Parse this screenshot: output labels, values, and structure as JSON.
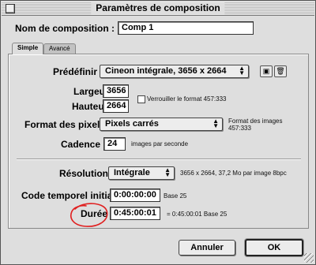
{
  "window": {
    "title": "Paramètres de composition"
  },
  "comp_name": {
    "label": "Nom de composition :",
    "value": "Comp 1"
  },
  "tabs": [
    {
      "label": "Simple"
    },
    {
      "label": "Avancé"
    }
  ],
  "preset": {
    "label": "Prédéfinir :",
    "value": "Cineon intégrale, 3656 x 2664",
    "save_icon": "disk-icon",
    "delete_icon": "trash-icon"
  },
  "width": {
    "label": "Largeur :",
    "value": "3656"
  },
  "height": {
    "label": "Hauteur :",
    "value": "2664"
  },
  "lock_ratio": {
    "label": "Verrouiller le format 457:333",
    "checked": false
  },
  "pixel_format": {
    "label": "Format des pixels :",
    "value": "Pixels carrés",
    "aspect_caption": "Format des images",
    "aspect_value": "457:333"
  },
  "frame_rate": {
    "label": "Cadence :",
    "value": "24",
    "unit": "images par seconde"
  },
  "resolution": {
    "label": "Résolution :",
    "value": "Intégrale",
    "info": "3656 x 2664, 37,2 Mo par image 8bpc"
  },
  "start_timecode": {
    "label": "Code temporel initial :",
    "value": "0:00:00:00",
    "base": "Base 25"
  },
  "duration": {
    "label": "Durée :",
    "value": "0:45:00:01",
    "info": "= 0:45:00:01  Base 25",
    "annotation_color": "#e02020"
  },
  "buttons": {
    "cancel": "Annuler",
    "ok": "OK"
  }
}
